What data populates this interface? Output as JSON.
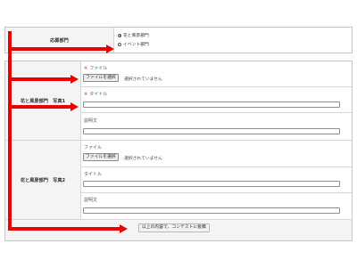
{
  "top_form": {
    "label": "応募部門",
    "options": [
      {
        "label": "花と風景部門",
        "selected": true
      },
      {
        "label": "イベント部門",
        "selected": false
      }
    ]
  },
  "form": {
    "group1": {
      "label": "花と風景部門　写真1",
      "file_label": "ファイル",
      "file_button": "ファイルを選択",
      "file_status": "選択されていません",
      "title_label": "タイトル",
      "title_value": "",
      "desc_label": "説明文",
      "desc_value": "",
      "required_mark": "※"
    },
    "group2": {
      "label": "花と風景部門　写真2",
      "file_label": "ファイル",
      "file_button": "ファイルを選択",
      "file_status": "選択されていません",
      "title_label": "タイトル",
      "title_value": "",
      "desc_label": "説明文",
      "desc_value": ""
    },
    "submit_label": "以上の内容で、コンテストに投稿"
  },
  "colors": {
    "annotation_arrow": "#ee0000",
    "radio_accent": "#1a5fd6",
    "required_mark": "#dd3333"
  }
}
